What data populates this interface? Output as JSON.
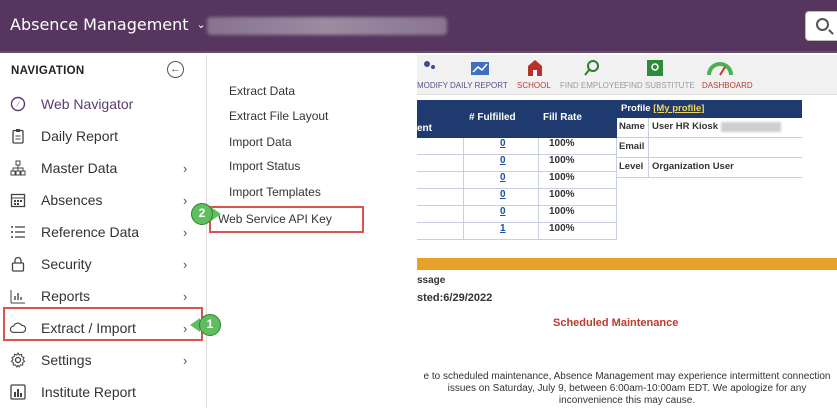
{
  "app": {
    "title": "Absence Management"
  },
  "nav": {
    "header": "NAVIGATION",
    "items": [
      {
        "label": "Web Navigator",
        "icon": "compass-icon",
        "active": true,
        "has_arrow": false
      },
      {
        "label": "Daily Report",
        "icon": "clipboard-icon",
        "has_arrow": false
      },
      {
        "label": "Master Data",
        "icon": "org-chart-icon",
        "has_arrow": true
      },
      {
        "label": "Absences",
        "icon": "calendar-icon",
        "has_arrow": true
      },
      {
        "label": "Reference Data",
        "icon": "list-icon",
        "has_arrow": true
      },
      {
        "label": "Security",
        "icon": "lock-icon",
        "has_arrow": true
      },
      {
        "label": "Reports",
        "icon": "bar-chart-icon",
        "has_arrow": true
      },
      {
        "label": "Extract / Import",
        "icon": "cloud-icon",
        "has_arrow": true
      },
      {
        "label": "Settings",
        "icon": "gear-icon",
        "has_arrow": true
      },
      {
        "label": "Institute Report",
        "icon": "report-icon",
        "has_arrow": false
      }
    ]
  },
  "submenu": {
    "items": [
      {
        "label": "Extract Data"
      },
      {
        "label": "Extract File Layout"
      },
      {
        "label": "Import Data"
      },
      {
        "label": "Import Status"
      },
      {
        "label": "Import Templates"
      },
      {
        "label": "Web Service API Key"
      }
    ]
  },
  "callouts": {
    "step1": "1",
    "step2": "2"
  },
  "background": {
    "toolbar": [
      "MODIFY",
      "DAILY REPORT",
      "SCHOOL",
      "FIND EMPLOYEE",
      "FIND SUBSTITUTE",
      "DASHBOARD"
    ],
    "table": {
      "headers": [
        "ent",
        "# Fulfilled",
        "Fill Rate"
      ],
      "rows": [
        {
          "fulfilled": "0",
          "rate": "100%"
        },
        {
          "fulfilled": "0",
          "rate": "100%"
        },
        {
          "fulfilled": "0",
          "rate": "100%"
        },
        {
          "fulfilled": "0",
          "rate": "100%"
        },
        {
          "fulfilled": "0",
          "rate": "100%"
        },
        {
          "fulfilled": "1",
          "rate": "100%"
        }
      ]
    },
    "profile": {
      "title": "Profile",
      "link": "[My profile]",
      "name_label": "Name",
      "name_value": "User HR Kiosk",
      "email_label": "Email",
      "level_label": "Level",
      "level_value": "Organization User"
    },
    "message_label": "ssage",
    "posted": "sted:6/29/2022",
    "maintenance_title": "Scheduled Maintenance",
    "maintenance_text": "e to scheduled maintenance, Absence Management may experience intermittent connection issues on Saturday, July 9, between 6:00am-10:00am EDT. We apologize for any inconvenience this may cause."
  },
  "colors": {
    "topbar": "#56355f",
    "accent": "#5b3c72",
    "highlight": "#d9534f",
    "callout": "#5fbf5f"
  }
}
